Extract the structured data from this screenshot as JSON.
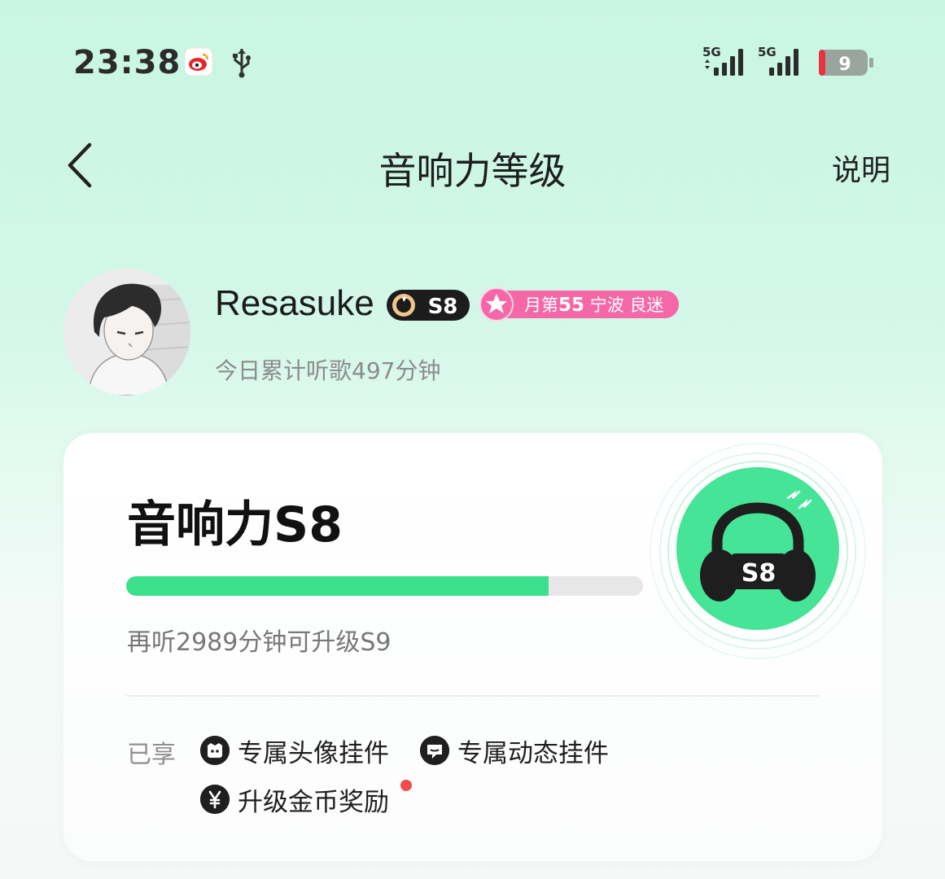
{
  "status_bar": {
    "time": "23:38",
    "icons": [
      "weibo-icon",
      "usb-icon"
    ],
    "signal_1": "5G",
    "signal_2": "5G",
    "battery": "9"
  },
  "nav": {
    "back_icon": "chevron-left-icon",
    "title": "音响力等级",
    "explain": "说明"
  },
  "profile": {
    "username": "Resasuke",
    "level_badge": "S8",
    "rank_prefix": "月第",
    "rank_number": "55",
    "rank_location": "宁波 良迷",
    "today_listen": "今日累计听歌497分钟"
  },
  "level_card": {
    "title": "音响力S8",
    "progress_fraction": 0.817,
    "upgrade_hint": "再听2989分钟可升级S9",
    "emblem_label": "S8",
    "enjoyed_label": "已享",
    "perks": [
      {
        "label": "专属头像挂件",
        "icon": "avatar-frame-icon"
      },
      {
        "label": "专属动态挂件",
        "icon": "chat-bubble-icon"
      },
      {
        "label": "升级金币奖励",
        "icon": "yen-coin-icon",
        "has_dot": true
      }
    ]
  },
  "colors": {
    "accent": "#3ae08b",
    "emblem_green": "#45e496",
    "badge_pink": "#f567a6",
    "dot_red": "#ef4d4d"
  }
}
